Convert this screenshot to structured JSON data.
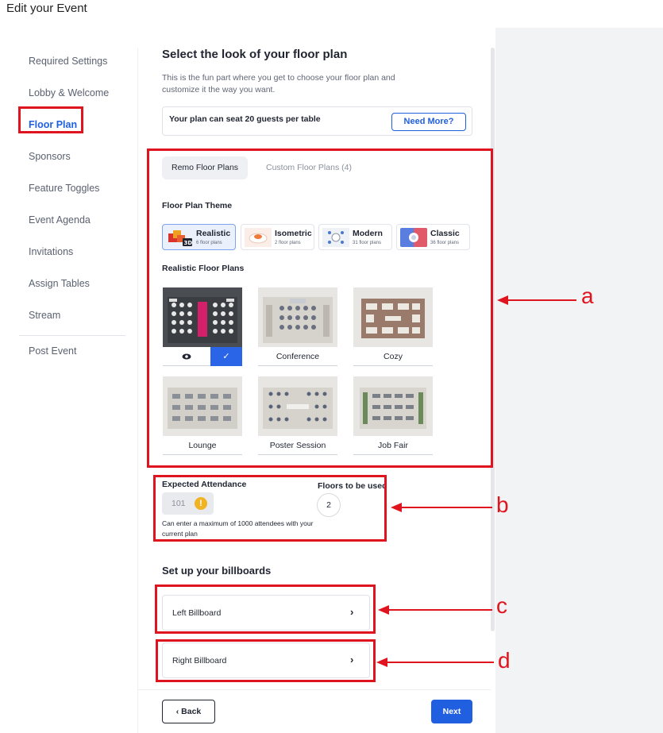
{
  "page_title": "Edit your Event",
  "sidebar": {
    "items": [
      {
        "label": "Required Settings"
      },
      {
        "label": "Lobby & Welcome"
      },
      {
        "label": "Floor Plan"
      },
      {
        "label": "Sponsors"
      },
      {
        "label": "Feature Toggles"
      },
      {
        "label": "Event Agenda"
      },
      {
        "label": "Invitations"
      },
      {
        "label": "Assign Tables"
      },
      {
        "label": "Stream"
      }
    ],
    "post_event": "Post Event",
    "active": "Floor Plan"
  },
  "main": {
    "title": "Select the look of your floor plan",
    "description": "This is the fun part where you get to choose your floor plan and customize it the way you want.",
    "seat_info": "Your plan can seat 20 guests per table",
    "need_more": "Need More?",
    "tabs": [
      {
        "label": "Remo Floor Plans",
        "active": true
      },
      {
        "label": "Custom Floor Plans (4)",
        "active": false
      }
    ],
    "theme_label": "Floor Plan Theme",
    "themes": [
      {
        "name": "Realistic",
        "count": "6 floor plans",
        "selected": true
      },
      {
        "name": "Isometric",
        "count": "2 floor plans",
        "selected": false
      },
      {
        "name": "Modern",
        "count": "31 floor plans",
        "selected": false
      },
      {
        "name": "Classic",
        "count": "36 floor plans",
        "selected": false
      }
    ],
    "plans_label": "Realistic Floor Plans",
    "plans": [
      {
        "name": "",
        "selected": true
      },
      {
        "name": "Conference"
      },
      {
        "name": "Cozy"
      },
      {
        "name": "Lounge"
      },
      {
        "name": "Poster Session"
      },
      {
        "name": "Job Fair"
      }
    ],
    "attendance": {
      "label": "Expected Attendance",
      "value": "101",
      "note": "Can enter a maximum of 1000 attendees with your current plan",
      "warn_icon": "!"
    },
    "floors": {
      "label": "Floors to be used",
      "value": "2"
    },
    "billboards": {
      "title": "Set up your billboards",
      "left": "Left Billboard",
      "right": "Right Billboard"
    },
    "back": "Back",
    "next": "Next"
  },
  "annotations": {
    "a": "a",
    "b": "b",
    "c": "c",
    "d": "d",
    "color": "#e0141e"
  },
  "colors": {
    "accent": "#1f5fe0",
    "selected_check": "#2a65e8"
  }
}
